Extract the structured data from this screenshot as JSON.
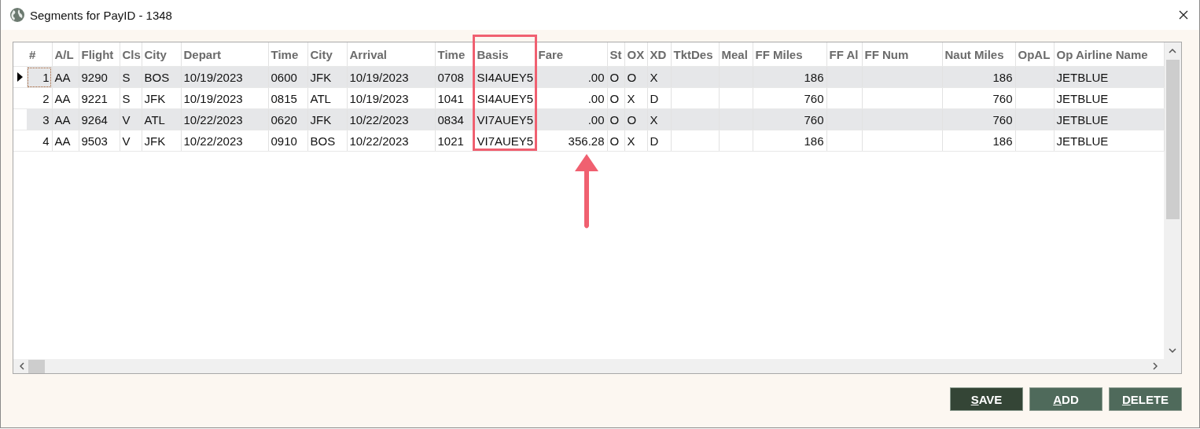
{
  "window": {
    "title": "Segments for PayID - 1348"
  },
  "table": {
    "columns": [
      {
        "label": "#",
        "highlighted": false
      },
      {
        "label": "A/L",
        "highlighted": false
      },
      {
        "label": "Flight",
        "highlighted": false
      },
      {
        "label": "Cls",
        "highlighted": false
      },
      {
        "label": "City",
        "highlighted": false
      },
      {
        "label": "Depart",
        "highlighted": false
      },
      {
        "label": "Time",
        "highlighted": false
      },
      {
        "label": "City",
        "highlighted": false
      },
      {
        "label": "Arrival",
        "highlighted": false
      },
      {
        "label": "Time",
        "highlighted": false
      },
      {
        "label": "Basis",
        "highlighted": true
      },
      {
        "label": "Fare",
        "highlighted": false
      },
      {
        "label": "St",
        "highlighted": false
      },
      {
        "label": "OX",
        "highlighted": false
      },
      {
        "label": "XD",
        "highlighted": false
      },
      {
        "label": "TktDes",
        "highlighted": false
      },
      {
        "label": "Meal",
        "highlighted": false
      },
      {
        "label": "FF Miles",
        "highlighted": false
      },
      {
        "label": "FF Al",
        "highlighted": false
      },
      {
        "label": "FF Num",
        "highlighted": false
      },
      {
        "label": "Naut Miles",
        "highlighted": false
      },
      {
        "label": "OpAL",
        "highlighted": false
      },
      {
        "label": "Op Airline Name",
        "highlighted": false
      }
    ],
    "rows": [
      {
        "current": true,
        "pointed": false,
        "cells": [
          "1",
          "AA",
          "9290",
          "S",
          "BOS",
          "10/19/2023",
          "0600",
          "JFK",
          "10/19/2023",
          "0708",
          "SI4AUEY5",
          ".00",
          "O",
          "O",
          "X",
          "",
          "",
          "186",
          "",
          "",
          "186",
          "",
          "JETBLUE"
        ]
      },
      {
        "current": false,
        "pointed": false,
        "cells": [
          "2",
          "AA",
          "9221",
          "S",
          "JFK",
          "10/19/2023",
          "0815",
          "ATL",
          "10/19/2023",
          "1041",
          "SI4AUEY5",
          ".00",
          "O",
          "X",
          "D",
          "",
          "",
          "760",
          "",
          "",
          "760",
          "",
          "JETBLUE"
        ]
      },
      {
        "current": false,
        "pointed": false,
        "cells": [
          "3",
          "AA",
          "9264",
          "V",
          "ATL",
          "10/22/2023",
          "0620",
          "JFK",
          "10/22/2023",
          "0834",
          "VI7AUEY5",
          ".00",
          "O",
          "O",
          "X",
          "",
          "",
          "760",
          "",
          "",
          "760",
          "",
          "JETBLUE"
        ]
      },
      {
        "current": false,
        "pointed": true,
        "cells": [
          "4",
          "AA",
          "9503",
          "V",
          "JFK",
          "10/22/2023",
          "0910",
          "BOS",
          "10/22/2023",
          "1021",
          "VI7AUEY5",
          "356.28",
          "O",
          "X",
          "D",
          "",
          "",
          "186",
          "",
          "",
          "186",
          "",
          "JETBLUE"
        ]
      }
    ]
  },
  "buttons": [
    {
      "label": "SAVE",
      "kind": "primary"
    },
    {
      "label": "ADD",
      "kind": "normal"
    },
    {
      "label": "DELETE",
      "kind": "normal"
    }
  ]
}
